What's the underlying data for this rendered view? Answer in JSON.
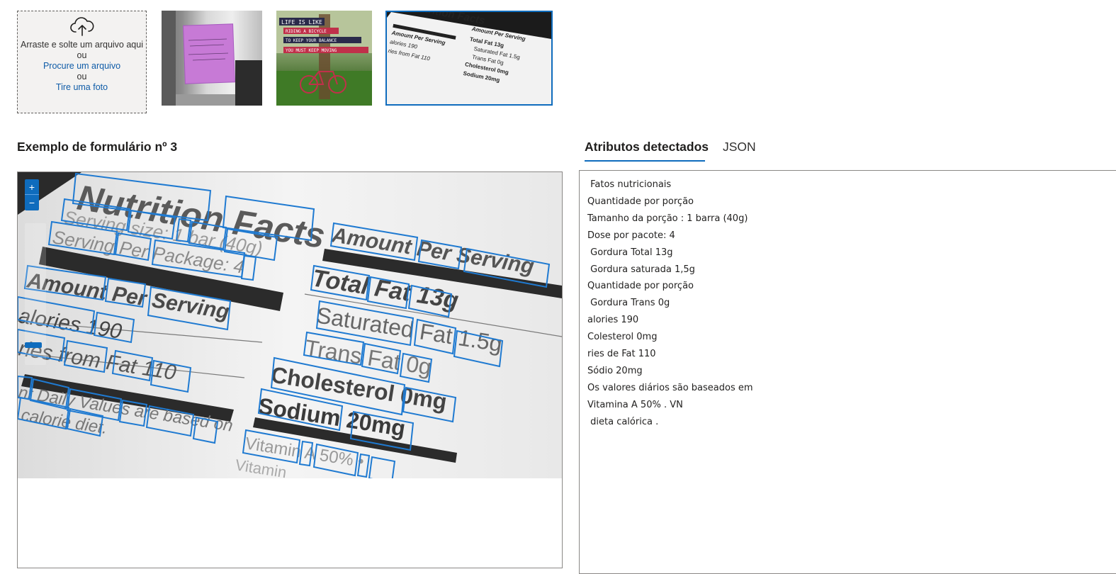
{
  "upload": {
    "icon": "cloud-upload-icon",
    "drag_text": "Arraste e solte um arquivo aqui",
    "or_1": "ou",
    "browse_link": "Procure um arquivo",
    "or_2": "ou",
    "photo_link": "Tire uma foto"
  },
  "thumbnails": [
    {
      "subject": "purple sticky note with handwriting"
    },
    {
      "subject": "Life is like riding a bicycle poster",
      "lines": [
        "LIFE IS LIKE",
        "RIDING A BICYCLE",
        "TO KEEP YOUR BALANCE",
        "YOU MUST KEEP MOVING"
      ]
    },
    {
      "subject": "nutrition facts label",
      "selected": true
    }
  ],
  "sample": {
    "title": "Exemplo de formulário nº 3",
    "label": {
      "heading": "Nutrition Facts",
      "serving_size": "Serving size: 1 bar (40g)",
      "servings_per_package": "Serving Per Package: 4",
      "amount_per_serving_left": "Amount Per Serving",
      "calories": "alories 190",
      "calories_from_fat": "ries from Fat 110",
      "daily_values": "nt Daily Values are based on",
      "calorie_diet": "calorie diet.",
      "amount_per_serving_right": "Amount Per Serving",
      "total_fat": "Total Fat 13g",
      "saturated_fat": "Saturated Fat 1.5g",
      "trans_fat": "Trans Fat 0g",
      "cholesterol": "Cholesterol 0mg",
      "sodium": "Sodium 20mg",
      "vitamin": "Vitamin A 50% •",
      "vitamin_bottom": "Vitamin"
    },
    "zoom_in_icon": "plus-icon",
    "zoom_out_icon": "minus-icon"
  },
  "tabs": {
    "detected": "Atributos detectados",
    "json": "JSON"
  },
  "detected_lines": [
    " Fatos nutricionais",
    "Quantidade por porção",
    "Tamanho da porção : 1 barra (40g)",
    "Dose por pacote: 4",
    " Gordura Total 13g",
    " Gordura saturada 1,5g",
    "Quantidade por porção",
    " Gordura Trans 0g",
    "alories 190",
    "Colesterol 0mg",
    "ries de Fat 110",
    "Sódio 20mg",
    "Os valores diários são baseados em",
    "Vitamina A 50% . VN",
    " dieta calórica ."
  ],
  "colors": {
    "accent": "#0f6cbd",
    "link": "#0f5ca8",
    "box": "#1f7ad1"
  }
}
